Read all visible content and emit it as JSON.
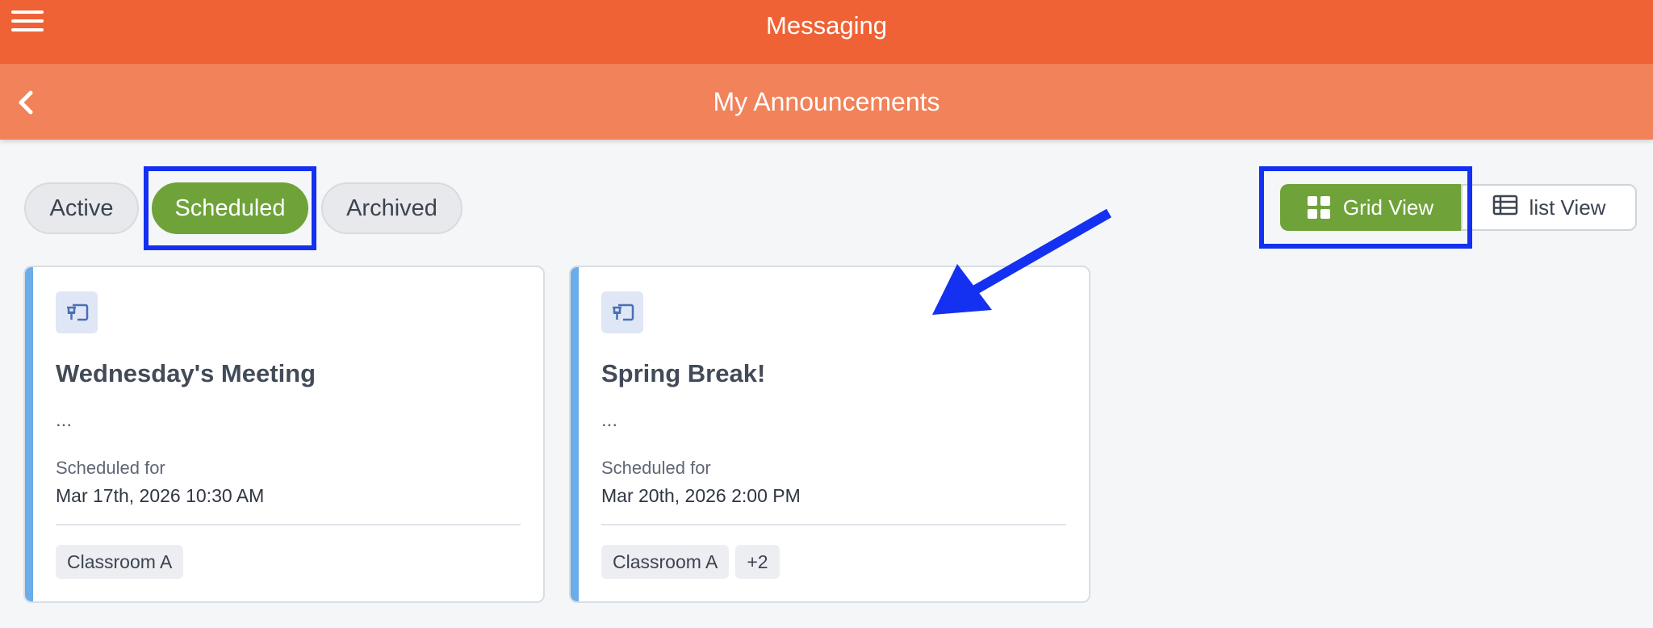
{
  "header": {
    "app_title": "Messaging",
    "page_title": "My Announcements"
  },
  "tabs": [
    {
      "label": "Active",
      "selected": false
    },
    {
      "label": "Scheduled",
      "selected": true
    },
    {
      "label": "Archived",
      "selected": false
    }
  ],
  "view_toggle": {
    "grid_label": "Grid View",
    "list_label": "list View",
    "selected": "grid"
  },
  "cards": [
    {
      "title": "Wednesday's Meeting",
      "preview": "...",
      "scheduled_label": "Scheduled for",
      "scheduled_date": "Mar 17th, 2026 10:30 AM",
      "tags": [
        "Classroom A"
      ]
    },
    {
      "title": "Spring Break!",
      "preview": "...",
      "scheduled_label": "Scheduled for",
      "scheduled_date": "Mar 20th, 2026 2:00 PM",
      "tags": [
        "Classroom A",
        "+2"
      ]
    }
  ],
  "colors": {
    "header": "#ef6235",
    "subheader": "#f1825a",
    "accent_green": "#6fa33a",
    "highlight_blue": "#1430f0",
    "card_stripe": "#6aade8"
  },
  "icons": [
    "menu-icon",
    "back-chevron-icon",
    "grid-icon",
    "list-icon",
    "pin-icon"
  ]
}
